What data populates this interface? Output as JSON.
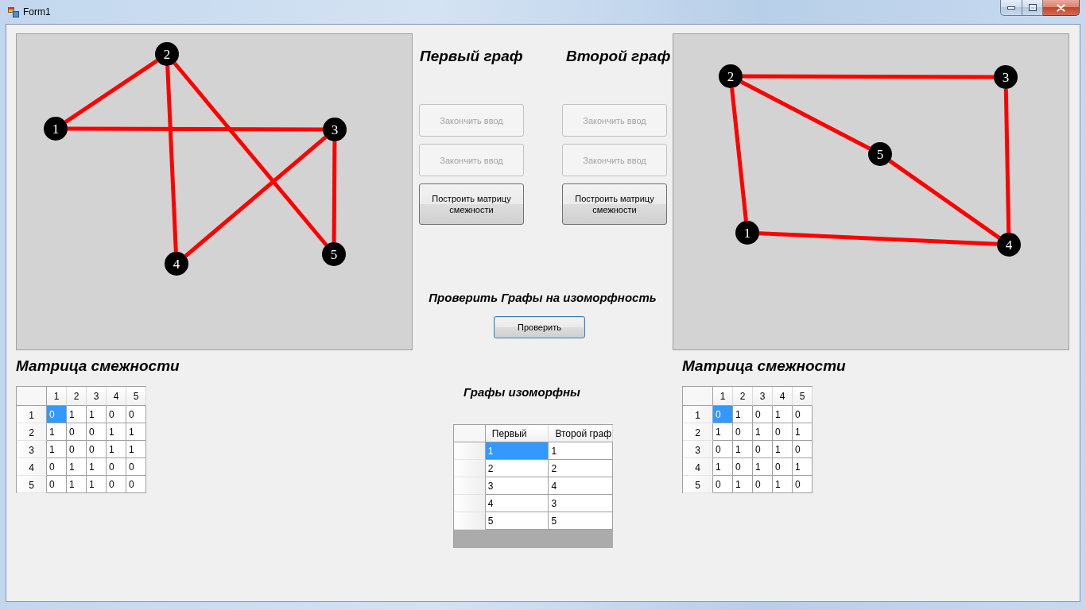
{
  "window": {
    "title": "Form1"
  },
  "graphs": [
    {
      "canvas": {
        "nodes": [
          {
            "label": "1",
            "links": [
              true,
              true,
              false,
              false
            ]
          },
          {
            "label": "2",
            "links": [
              false,
              true,
              true
            ]
          },
          {
            "label": "3",
            "links": [
              true,
              true
            ]
          },
          {
            "label": "4",
            "links": [
              false
            ]
          },
          {
            "label": "5"
          }
        ]
      },
      "heading": "Первый граф",
      "buttons": [
        {
          "label": "Закончить ввод",
          "disabled": true
        },
        {
          "label": "Закончить ввод",
          "disabled": true
        },
        {
          "label": "Построить матрицу смежности",
          "disabled": false
        }
      ],
      "matrix_title": "Матрица смежности",
      "matrix": {
        "columns": [
          "1",
          "2",
          "3",
          "4",
          "5"
        ],
        "rows": [
          {
            "header": "1",
            "cells": [
              {
                "value": "0",
                "selected": true
              },
              {
                "value": "1",
                "selected": false
              },
              {
                "value": "1",
                "selected": false
              },
              {
                "value": "0",
                "selected": false
              },
              {
                "value": "0",
                "selected": false
              }
            ]
          },
          {
            "header": "2",
            "cells": [
              {
                "value": "1",
                "selected": false
              },
              {
                "value": "0",
                "selected": false
              },
              {
                "value": "0",
                "selected": false
              },
              {
                "value": "1",
                "selected": false
              },
              {
                "value": "1",
                "selected": false
              }
            ]
          },
          {
            "header": "3",
            "cells": [
              {
                "value": "1",
                "selected": false
              },
              {
                "value": "0",
                "selected": false
              },
              {
                "value": "0",
                "selected": false
              },
              {
                "value": "1",
                "selected": false
              },
              {
                "value": "1",
                "selected": false
              }
            ]
          },
          {
            "header": "4",
            "cells": [
              {
                "value": "0",
                "selected": false
              },
              {
                "value": "1",
                "selected": false
              },
              {
                "value": "1",
                "selected": false
              },
              {
                "value": "0",
                "selected": false
              },
              {
                "value": "0",
                "selected": false
              }
            ]
          },
          {
            "header": "5",
            "cells": [
              {
                "value": "0",
                "selected": false
              },
              {
                "value": "1",
                "selected": false
              },
              {
                "value": "1",
                "selected": false
              },
              {
                "value": "0",
                "selected": false
              },
              {
                "value": "0",
                "selected": false
              }
            ]
          }
        ]
      }
    },
    {
      "canvas": {
        "nodes": [
          {
            "label": "1",
            "links": [
              true,
              false,
              true,
              false
            ]
          },
          {
            "label": "2",
            "links": [
              true,
              false,
              true
            ]
          },
          {
            "label": "3",
            "links": [
              true,
              false
            ]
          },
          {
            "label": "4",
            "links": [
              true
            ]
          },
          {
            "label": "5"
          }
        ]
      },
      "heading": "Второй граф",
      "buttons": [
        {
          "label": "Закончить ввод",
          "disabled": true
        },
        {
          "label": "Закончить ввод",
          "disabled": true
        },
        {
          "label": "Построить матрицу смежности",
          "disabled": false
        }
      ],
      "matrix_title": "Матрица смежности",
      "matrix": {
        "columns": [
          "1",
          "2",
          "3",
          "4",
          "5"
        ],
        "rows": [
          {
            "header": "1",
            "cells": [
              {
                "value": "0",
                "selected": true
              },
              {
                "value": "1",
                "selected": false
              },
              {
                "value": "0",
                "selected": false
              },
              {
                "value": "1",
                "selected": false
              },
              {
                "value": "0",
                "selected": false
              }
            ]
          },
          {
            "header": "2",
            "cells": [
              {
                "value": "1",
                "selected": false
              },
              {
                "value": "0",
                "selected": false
              },
              {
                "value": "1",
                "selected": false
              },
              {
                "value": "0",
                "selected": false
              },
              {
                "value": "1",
                "selected": false
              }
            ]
          },
          {
            "header": "3",
            "cells": [
              {
                "value": "0",
                "selected": false
              },
              {
                "value": "1",
                "selected": false
              },
              {
                "value": "0",
                "selected": false
              },
              {
                "value": "1",
                "selected": false
              },
              {
                "value": "0",
                "selected": false
              }
            ]
          },
          {
            "header": "4",
            "cells": [
              {
                "value": "1",
                "selected": false
              },
              {
                "value": "0",
                "selected": false
              },
              {
                "value": "1",
                "selected": false
              },
              {
                "value": "0",
                "selected": false
              },
              {
                "value": "1",
                "selected": false
              }
            ]
          },
          {
            "header": "5",
            "cells": [
              {
                "value": "0",
                "selected": false
              },
              {
                "value": "1",
                "selected": false
              },
              {
                "value": "0",
                "selected": false
              },
              {
                "value": "1",
                "selected": false
              },
              {
                "value": "0",
                "selected": false
              }
            ]
          }
        ]
      }
    }
  ],
  "check": {
    "heading": "Проверить Графы на изоморфность",
    "button": {
      "label": "Проверить",
      "focused": true
    }
  },
  "result": {
    "heading": "Графы изоморфны",
    "table": {
      "columns": [
        "Первый",
        "Второй граф"
      ],
      "rows": [
        {
          "cells": [
            {
              "value": "1",
              "selected": true
            },
            {
              "value": "1",
              "selected": false
            }
          ]
        },
        {
          "cells": [
            {
              "value": "2",
              "selected": false
            },
            {
              "value": "2",
              "selected": false
            }
          ]
        },
        {
          "cells": [
            {
              "value": "3",
              "selected": false
            },
            {
              "value": "4",
              "selected": false
            }
          ]
        },
        {
          "cells": [
            {
              "value": "4",
              "selected": false
            },
            {
              "value": "3",
              "selected": false
            }
          ]
        },
        {
          "cells": [
            {
              "value": "5",
              "selected": false
            },
            {
              "value": "5",
              "selected": false
            }
          ]
        }
      ]
    }
  }
}
